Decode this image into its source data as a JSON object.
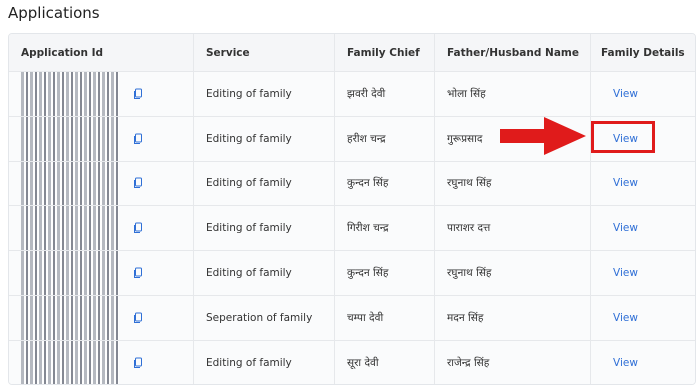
{
  "page": {
    "title": "Applications"
  },
  "table": {
    "headers": [
      "Application Id",
      "Service",
      "Family Chief",
      "Father/Husband Name",
      "Family Details"
    ],
    "rows": [
      {
        "service": "Editing of family",
        "chief": "झवरी देवी",
        "father": "भोला सिंह",
        "action": "View"
      },
      {
        "service": "Editing of family",
        "chief": "हरीश चन्द्र",
        "father": "गुरूप्रसाद",
        "action": "View"
      },
      {
        "service": "Editing of family",
        "chief": "कुन्दन सिंह",
        "father": "रघुनाथ सिंह",
        "action": "View"
      },
      {
        "service": "Editing of family",
        "chief": "गिरीश चन्द्र",
        "father": "पाराशर दत्त",
        "action": "View"
      },
      {
        "service": "Editing of family",
        "chief": "कुन्दन सिंह",
        "father": "रघुनाथ सिंह",
        "action": "View"
      },
      {
        "service": "Seperation of family",
        "chief": "चम्पा देवी",
        "father": "मदन सिंह",
        "action": "View"
      },
      {
        "service": "Editing of family",
        "chief": "सूरा देवी",
        "father": "राजेन्द्र सिंह",
        "action": "View"
      }
    ]
  },
  "icons": {
    "copy": "copy-icon",
    "arrow": "arrow-right-icon"
  },
  "colors": {
    "link": "#2f6fd6",
    "highlight": "#e01b1b",
    "arrow": "#e01b1b"
  }
}
